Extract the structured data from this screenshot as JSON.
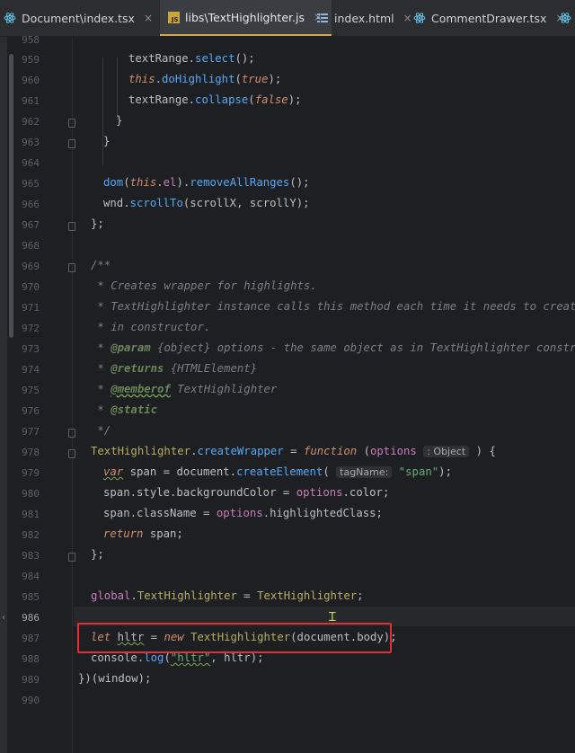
{
  "tabs": [
    {
      "label": "Document\\index.tsx",
      "icon": "react-icon",
      "active": false
    },
    {
      "label": "libs\\TextHighlighter.js",
      "icon": "js-icon",
      "active": true
    },
    {
      "label": "index.html",
      "icon": "html-file-icon",
      "active": false
    },
    {
      "label": "CommentDrawer.tsx",
      "icon": "react-icon",
      "active": false
    },
    {
      "label": "",
      "icon": "react-icon",
      "active": false
    }
  ],
  "close_glyph": "×",
  "js_badge": "JS",
  "line_numbers": [
    "958",
    "959",
    "960",
    "961",
    "962",
    "963",
    "964",
    "965",
    "966",
    "967",
    "968",
    "969",
    "970",
    "971",
    "972",
    "973",
    "974",
    "975",
    "976",
    "977",
    "978",
    "979",
    "980",
    "981",
    "982",
    "983",
    "984",
    "985",
    "986",
    "987",
    "988",
    "989",
    "990"
  ],
  "current_line": "986",
  "code": {
    "l959": {
      "a": "textRange.",
      "b": "select",
      "c": "();"
    },
    "l960": {
      "a": "this",
      "b": ".",
      "c": "doHighlight",
      "d": "(",
      "e": "true",
      "f": ");"
    },
    "l961": {
      "a": "textRange.",
      "b": "collapse",
      "c": "(",
      "d": "false",
      "e": ");"
    },
    "l962": "}",
    "l963": "}",
    "l965": {
      "a": "dom",
      "b": "(",
      "c": "this",
      "d": ".",
      "e": "el",
      "f": ").",
      "g": "removeAllRanges",
      "h": "();"
    },
    "l966": {
      "a": "wnd.",
      "b": "scrollTo",
      "c": "(scrollX, scrollY);"
    },
    "l967": "};",
    "l969": "/**",
    "l970": " * Creates wrapper for highlights.",
    "l971": " * TextHighlighter instance calls this method each time it needs to create hi",
    "l972": " * in constructor.",
    "l973": {
      "star": " * ",
      "tag": "@param",
      "rest": " {object} options - the same object as in TextHighlighter constructo"
    },
    "l974": {
      "star": " * ",
      "tag": "@returns",
      "rest": " {HTMLElement}"
    },
    "l975": {
      "star": " * ",
      "tag": "@memberof",
      "rest": " TextHighlighter"
    },
    "l976": {
      "star": " * ",
      "tag": "@static",
      "rest": ""
    },
    "l977": " */",
    "l978": {
      "a": "TextHighlighter",
      "b": ".",
      "c": "createWrapper",
      "d": " = ",
      "e": "function",
      "f": " (",
      "g": "options",
      "hint": ": Object",
      "h": " ) {"
    },
    "l979": {
      "a": "var",
      "b": " span = document.",
      "c": "createElement",
      "d": "( ",
      "hint": "tagName:",
      "e": "\"span\"",
      "f": ");"
    },
    "l980": {
      "a": "span.style.backgroundColor = ",
      "b": "options",
      "c": ".color;"
    },
    "l981": {
      "a": "span.className = ",
      "b": "options",
      "c": ".highlightedClass;"
    },
    "l982": {
      "a": "return",
      "b": " span;"
    },
    "l983": "};",
    "l985": {
      "a": "global",
      "b": ".",
      "c": "TextHighlighter",
      "d": " = ",
      "e": "TextHighlighter",
      "f": ";"
    },
    "l987": {
      "a": "let",
      "b": " ",
      "c": "hltr",
      "d": " = ",
      "e": "new",
      "f": " ",
      "g": "TextHighlighter",
      "h": "(document.body);"
    },
    "l988": {
      "a": "console.",
      "b": "log",
      "c": "(",
      "d": "\"hltr\"",
      "e": ", hltr);"
    },
    "l989": "})(window);"
  },
  "colors": {
    "background": "#1e1f22",
    "keyword": "#cf8e6d",
    "function": "#56a8f5",
    "string": "#6aab73",
    "comment": "#7a7e85",
    "highlight_box": "#e0303a",
    "active_tab_underline": "#e2a338"
  }
}
